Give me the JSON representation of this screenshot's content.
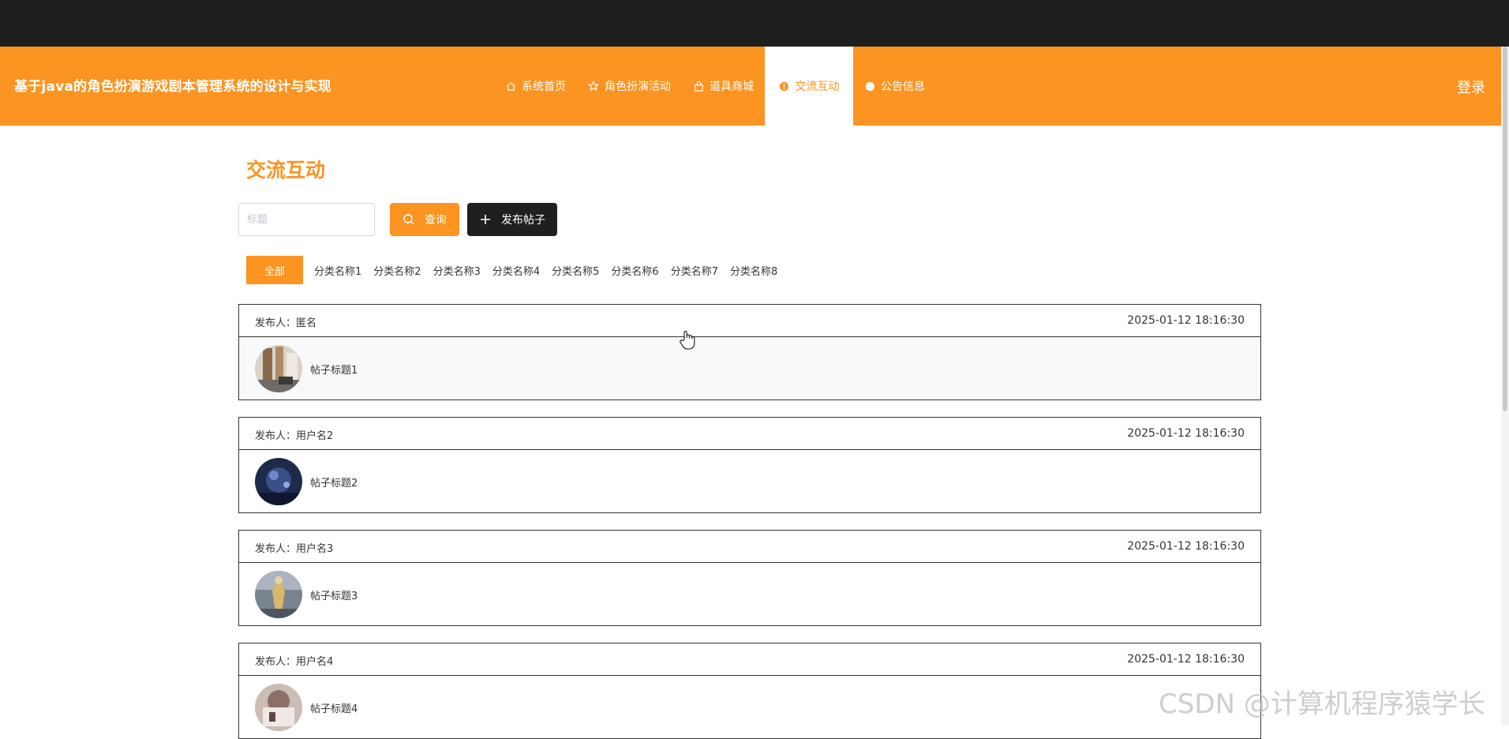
{
  "header": {
    "site_title": "基于java的角色扮演游戏剧本管理系统的设计与实现",
    "login_label": "登录",
    "nav": [
      {
        "label": "系统首页",
        "icon": "home-icon"
      },
      {
        "label": "角色扮演活动",
        "icon": "star-icon"
      },
      {
        "label": "道具商城",
        "icon": "bag-icon"
      },
      {
        "label": "交流互动",
        "icon": "info-icon"
      },
      {
        "label": "公告信息",
        "icon": "circle-icon"
      }
    ],
    "active_nav_index": 3
  },
  "page": {
    "title": "交流互动",
    "search_placeholder": "标题",
    "search_value": "",
    "search_button": "查询",
    "post_button": "发布帖子"
  },
  "categories": {
    "active_index": 0,
    "items": [
      "全部",
      "分类名称1",
      "分类名称2",
      "分类名称3",
      "分类名称4",
      "分类名称5",
      "分类名称6",
      "分类名称7",
      "分类名称8"
    ]
  },
  "posts": [
    {
      "poster": "发布人：匿名",
      "time": "2025-01-12 18:16:30",
      "title": "帖子标题1"
    },
    {
      "poster": "发布人：用户名2",
      "time": "2025-01-12 18:16:30",
      "title": "帖子标题2"
    },
    {
      "poster": "发布人：用户名3",
      "time": "2025-01-12 18:16:30",
      "title": "帖子标题3"
    },
    {
      "poster": "发布人：用户名4",
      "time": "2025-01-12 18:16:30",
      "title": "帖子标题4"
    }
  ],
  "watermark": "CSDN @计算机程序猿学长",
  "colors": {
    "accent": "#fc9421",
    "dark": "#1f1f1f"
  }
}
